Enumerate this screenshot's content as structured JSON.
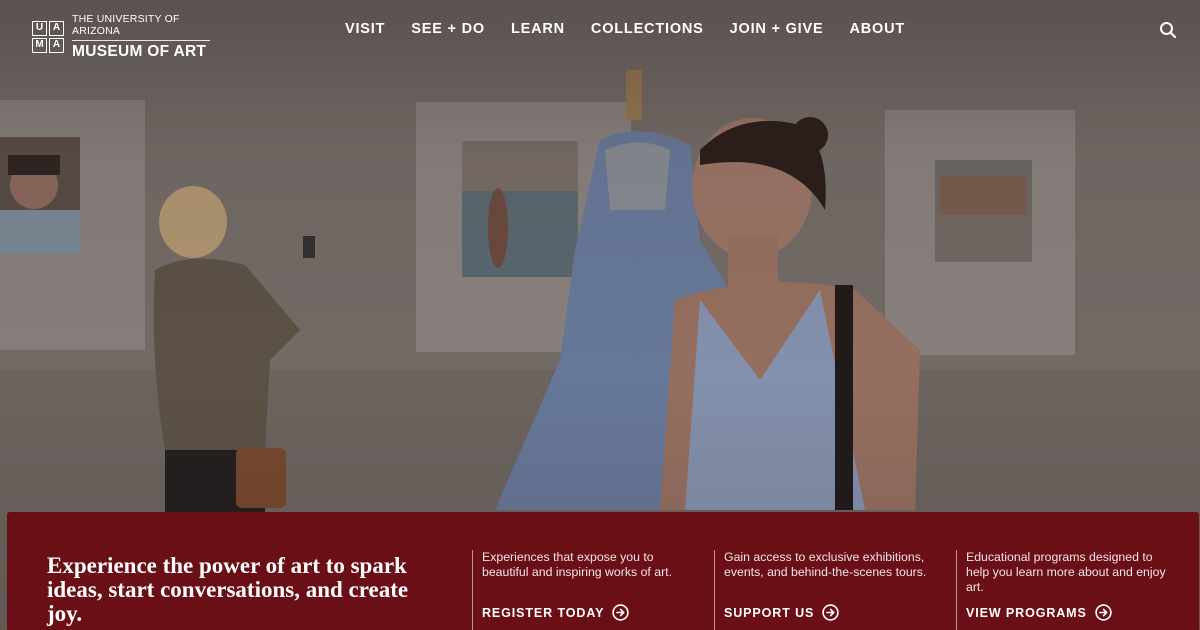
{
  "site": {
    "logo": {
      "mark_letters": [
        "U",
        "A",
        "M",
        "A"
      ],
      "top_line": "THE UNIVERSITY OF ARIZONA",
      "bottom_line": "MUSEUM OF ART"
    },
    "nav": [
      {
        "label": "VISIT"
      },
      {
        "label": "SEE + DO"
      },
      {
        "label": "LEARN"
      },
      {
        "label": "COLLECTIONS"
      },
      {
        "label": "JOIN + GIVE"
      },
      {
        "label": "ABOUT"
      }
    ],
    "search_icon": "search-icon"
  },
  "hero": {
    "image_subject": "gallery-visitors-photo"
  },
  "band": {
    "background_color": "#6b0f17",
    "heading": "Experience the power of art to spark ideas, start conversations, and create joy.",
    "columns": [
      {
        "text": "Experiences that expose you to beautiful and inspiring works of art.",
        "link_label": "REGISTER TODAY",
        "icon": "arrow-right-circle-icon"
      },
      {
        "text": "Gain access to exclusive exhibitions, events, and behind-the-scenes tours.",
        "link_label": "SUPPORT US",
        "icon": "arrow-right-circle-icon"
      },
      {
        "text": "Educational programs designed to help you learn more about and enjoy art.",
        "link_label": "VIEW PROGRAMS",
        "icon": "arrow-right-circle-icon"
      }
    ]
  }
}
